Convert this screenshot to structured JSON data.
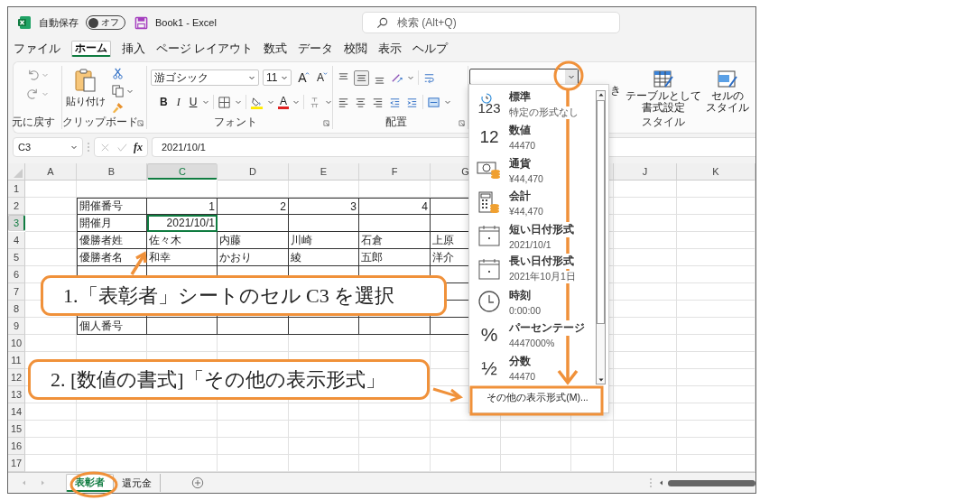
{
  "window": {
    "title": "Book1 - Excel",
    "autosave": {
      "label": "自動保存",
      "on": false,
      "state_text": "オフ"
    },
    "search": {
      "placeholder": "検索 (Alt+Q)"
    }
  },
  "menu_tabs": [
    {
      "label": "ファイル",
      "selected": false
    },
    {
      "label": "ホーム",
      "selected": true
    },
    {
      "label": "挿入",
      "selected": false
    },
    {
      "label": "ページ レイアウト",
      "selected": false
    },
    {
      "label": "数式",
      "selected": false
    },
    {
      "label": "データ",
      "selected": false
    },
    {
      "label": "校閲",
      "selected": false
    },
    {
      "label": "表示",
      "selected": false
    },
    {
      "label": "ヘルプ",
      "selected": false
    }
  ],
  "ribbon": {
    "groups": [
      {
        "label": "元に戻す"
      },
      {
        "label": "クリップボード"
      },
      {
        "label": "フォント"
      },
      {
        "label": "配置"
      },
      {
        "label": "スタイル"
      }
    ],
    "paste_label": "貼り付け",
    "font_name": "游ゴシック",
    "font_size": "11",
    "grow_glyph": "A",
    "shrink_glyph": "A",
    "style_glyphs": [
      "B",
      "I",
      "U"
    ],
    "font_color_glyph": "A",
    "conditional_fragment": "き",
    "table_format_label": [
      "テーブルとして",
      "書式設定"
    ],
    "cell_style_label": [
      "セルの",
      "スタイル"
    ]
  },
  "formula_bar": {
    "name_box": "C3",
    "fx": "fx",
    "value": "2021/10/1"
  },
  "sheet": {
    "columns": [
      {
        "label": "A",
        "selected": false
      },
      {
        "label": "B",
        "selected": false
      },
      {
        "label": "C",
        "selected": true
      },
      {
        "label": "D",
        "selected": false
      },
      {
        "label": "E",
        "selected": false
      },
      {
        "label": "F",
        "selected": false
      },
      {
        "label": "G",
        "selected": false
      },
      {
        "label": "J",
        "selected": false
      },
      {
        "label": "K",
        "selected": false
      }
    ],
    "rows": [
      {
        "number": "1",
        "selected": false,
        "kind": "blank"
      },
      {
        "number": "2",
        "selected": false,
        "kind": "numbers",
        "cells": [
          {
            "text": "開催番号",
            "selected": false
          },
          {
            "text": "1",
            "selected": false
          },
          {
            "text": "2",
            "selected": false
          },
          {
            "text": "3",
            "selected": false
          },
          {
            "text": "4",
            "selected": false
          },
          null
        ]
      },
      {
        "number": "3",
        "selected": true,
        "kind": "numbers",
        "cells": [
          {
            "text": "開催月",
            "selected": false
          },
          {
            "text": "2021/10/1",
            "selected": true
          },
          null,
          null,
          null,
          null
        ]
      },
      {
        "number": "4",
        "selected": false,
        "kind": "table",
        "cells": [
          {
            "text": "優勝者姓",
            "selected": false
          },
          {
            "text": "佐々木",
            "selected": false
          },
          {
            "text": "内藤",
            "selected": false
          },
          {
            "text": "川崎",
            "selected": false
          },
          {
            "text": "石倉",
            "selected": false
          },
          {
            "text": "上原",
            "selected": false
          }
        ]
      },
      {
        "number": "5",
        "selected": false,
        "kind": "table",
        "cells": [
          {
            "text": "優勝者名",
            "selected": false
          },
          {
            "text": "和幸",
            "selected": false
          },
          {
            "text": "かおり",
            "selected": false
          },
          {
            "text": "綾",
            "selected": false
          },
          {
            "text": "五郎",
            "selected": false
          },
          {
            "text": "洋介",
            "selected": false
          }
        ]
      },
      {
        "number": "6",
        "selected": false,
        "kind": "table"
      },
      {
        "number": "7",
        "selected": false,
        "kind": "table"
      },
      {
        "number": "8",
        "selected": false,
        "kind": "table"
      },
      {
        "number": "9",
        "selected": false,
        "kind": "table",
        "cells": [
          {
            "text": "個人番号",
            "selected": false
          }
        ]
      },
      {
        "number": "10",
        "selected": false,
        "kind": "blank"
      },
      {
        "number": "11",
        "selected": false,
        "kind": "blank"
      },
      {
        "number": "12",
        "selected": false,
        "kind": "blank"
      },
      {
        "number": "13",
        "selected": false,
        "kind": "blank"
      },
      {
        "number": "14",
        "selected": false,
        "kind": "blank"
      },
      {
        "number": "15",
        "selected": false,
        "kind": "blank"
      },
      {
        "number": "16",
        "selected": false,
        "kind": "blank"
      },
      {
        "number": "17",
        "selected": false,
        "kind": "blank"
      }
    ]
  },
  "sheet_tabs": [
    {
      "label": "表彰者",
      "selected": true
    },
    {
      "label": "還元金",
      "selected": false
    }
  ],
  "number_format_menu": {
    "items": [
      {
        "kind": "general",
        "glyph": "123",
        "name": "標準",
        "sample": "特定の形式なし"
      },
      {
        "kind": "number",
        "glyph": "12",
        "name": "数値",
        "sample": "44470"
      },
      {
        "kind": "currency",
        "name": "通貨",
        "sample": "¥44,470"
      },
      {
        "kind": "accounting",
        "name": "会計",
        "sample": "¥44,470"
      },
      {
        "kind": "short-date",
        "name": "短い日付形式",
        "sample": "2021/10/1"
      },
      {
        "kind": "long-date",
        "name": "長い日付形式",
        "sample": "2021年10月1日"
      },
      {
        "kind": "time",
        "name": "時刻",
        "sample": "0:00:00"
      },
      {
        "kind": "percent",
        "glyph": "%",
        "name": "パーセンテージ",
        "sample": "4447000%"
      },
      {
        "kind": "fraction",
        "glyph": "½",
        "name": "分数",
        "sample": "44470"
      }
    ],
    "footer": "その他の表示形式(M)..."
  },
  "callouts": [
    {
      "text": "1.「表彰者」シートのセル C3 を選択"
    },
    {
      "text": "2. [数値の書式]「その他の表示形式」"
    }
  ]
}
